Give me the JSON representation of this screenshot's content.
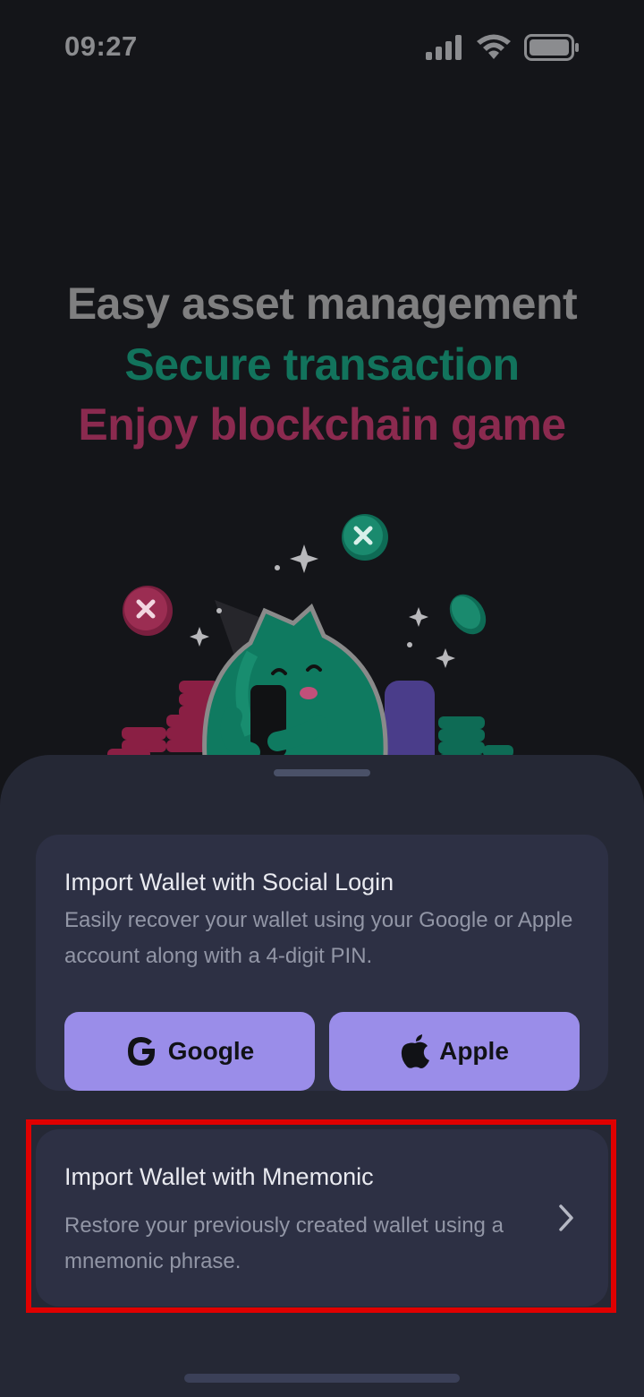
{
  "status_bar": {
    "time": "09:27",
    "icons": [
      "cellular-signal-icon",
      "wifi-icon",
      "battery-icon"
    ]
  },
  "hero": {
    "line1": "Easy asset management",
    "line2": "Secure transaction",
    "line3": "Enjoy blockchain game",
    "colors": {
      "line1": "#7f7f80",
      "line2": "#12735c",
      "line3": "#8b2a4f"
    },
    "illustration": "mascot-with-phone-and-coins"
  },
  "social_card": {
    "title": "Import Wallet with Social Login",
    "description": "Easily recover your wallet using your Google or Apple account along with a 4-digit PIN.",
    "google_label": "Google",
    "apple_label": "Apple",
    "button_color": "#9a8de9"
  },
  "mnemonic_card": {
    "title": "Import Wallet with Mnemonic",
    "description": "Restore your previously created wallet using a mnemonic phrase.",
    "icon": "chevron-right-icon"
  }
}
